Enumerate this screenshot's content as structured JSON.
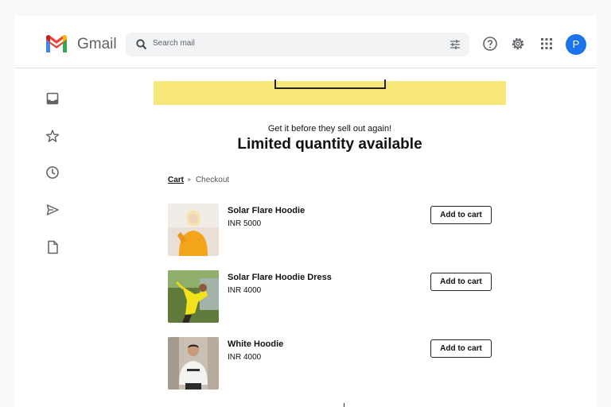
{
  "header": {
    "brand": "Gmail",
    "search_placeholder": "Search mail",
    "avatar_initial": "P",
    "colors": {
      "avatar": "#1a73e8",
      "search_bg": "#f1f3f4"
    },
    "icons": [
      "gmail-logo",
      "search-icon",
      "tune-icon",
      "help-icon",
      "settings-icon",
      "apps-icon"
    ]
  },
  "sidebar": {
    "icons": [
      "inbox-icon",
      "star-icon",
      "clock-icon",
      "send-icon",
      "document-icon"
    ]
  },
  "email": {
    "banner_color": "#f8e87a",
    "tagline": "Get it before they sell out again!",
    "headline": "Limited quantity available",
    "breadcrumb": {
      "cart": "Cart",
      "checkout": "Checkout"
    },
    "products": [
      {
        "name": "Solar Flare Hoodie",
        "price": "INR 5000",
        "button": "Add to cart"
      },
      {
        "name": "Solar Flare Hoodie Dress",
        "price": "INR 4000",
        "button": "Add to cart"
      },
      {
        "name": "White Hoodie",
        "price": "INR 4000",
        "button": "Add to cart"
      }
    ]
  }
}
